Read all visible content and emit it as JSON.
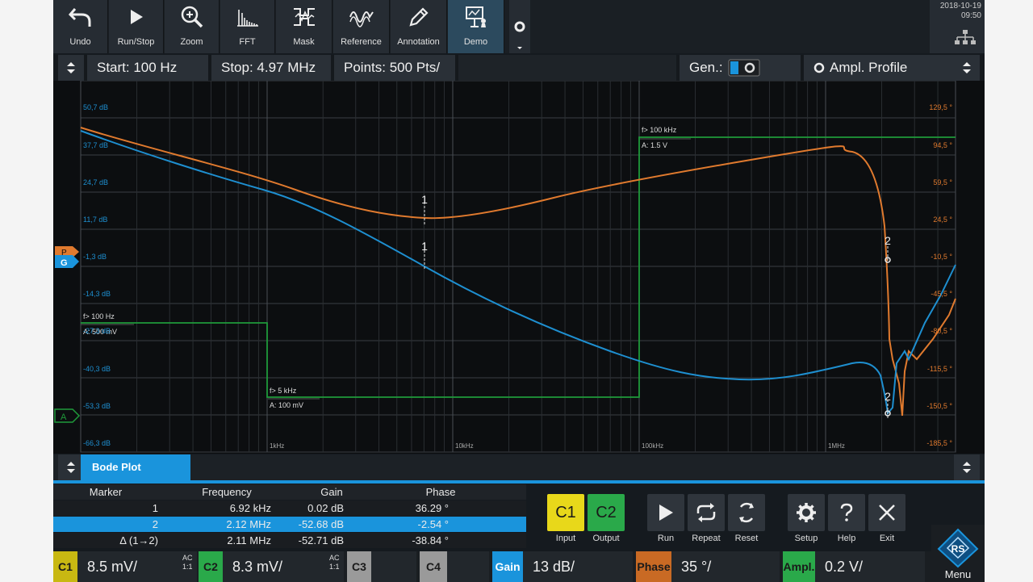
{
  "toolbar": {
    "buttons": [
      {
        "label": "Undo",
        "icon": "undo-icon"
      },
      {
        "label": "Run/Stop",
        "icon": "play-icon"
      },
      {
        "label": "Zoom",
        "icon": "zoom-icon"
      },
      {
        "label": "FFT",
        "icon": "fft-icon"
      },
      {
        "label": "Mask",
        "icon": "mask-icon"
      },
      {
        "label": "Reference",
        "icon": "reference-icon"
      },
      {
        "label": "Annotation",
        "icon": "pencil-icon"
      },
      {
        "label": "Demo",
        "icon": "demo-icon"
      }
    ],
    "date": "2018-10-19",
    "time": "09:50"
  },
  "settings": {
    "start": "Start: 100 Hz",
    "stop": "Stop: 4.97 MHz",
    "points": "Points: 500 Pts/",
    "gen": "Gen.:",
    "profile": "Ampl. Profile"
  },
  "plot": {
    "gain_ticks": [
      "50,7 dB",
      "37,7 dB",
      "24,7 dB",
      "11,7 dB",
      "-1,3 dB",
      "-14,3 dB",
      "-27,3 dB",
      "-40,3 dB",
      "-53,3 dB",
      "-66,3 dB"
    ],
    "phase_ticks": [
      "129,5 °",
      "94,5 °",
      "59,5 °",
      "24,5 °",
      "-10,5 °",
      "-45,5 °",
      "-80,5 °",
      "-115,5 °",
      "-150,5 °",
      "-185,5 °"
    ],
    "freq_ticks": [
      "1kHz",
      "10kHz",
      "100kHz",
      "1MHz"
    ],
    "profile_labels": [
      {
        "f": "f> 100 Hz",
        "a": "A: 500 mV"
      },
      {
        "f": "f> 5 kHz",
        "a": "A: 100 mV"
      },
      {
        "f": "f> 100 kHz",
        "a": "A: 1.5 V"
      }
    ],
    "markers": [
      "1",
      "1",
      "2",
      "2"
    ],
    "left_tags": [
      "P",
      "G",
      "A"
    ],
    "colors": {
      "gain": "#1e8fd0",
      "phase": "#e07a2e",
      "profile": "#1f9a3a",
      "grid": "#3a3f44"
    }
  },
  "bode": {
    "title": "Bode Plot"
  },
  "marker_table": {
    "headers": [
      "Marker",
      "Frequency",
      "Gain",
      "Phase"
    ],
    "rows": [
      [
        "1",
        "6.92 kHz",
        "0.02 dB",
        "36.29 °"
      ],
      [
        "2",
        "2.12 MHz",
        "-52.68 dB",
        "-2.54 °"
      ],
      [
        "Δ (1→2)",
        "2.11 MHz",
        "-52.71 dB",
        "-38.84 °"
      ]
    ]
  },
  "controls": {
    "input": {
      "tag": "C1",
      "label": "Input"
    },
    "output": {
      "tag": "C2",
      "label": "Output"
    },
    "run": "Run",
    "repeat": "Repeat",
    "reset": "Reset",
    "setup": "Setup",
    "help": "Help",
    "exit": "Exit",
    "menu": "Menu"
  },
  "status": {
    "c1": {
      "tag": "C1",
      "value": "8.5 mV/",
      "ac": "AC",
      "ratio": "1:1"
    },
    "c2": {
      "tag": "C2",
      "value": "8.3 mV/",
      "ac": "AC",
      "ratio": "1:1"
    },
    "c3": {
      "tag": "C3"
    },
    "c4": {
      "tag": "C4"
    },
    "gain": {
      "tag": "Gain",
      "value": "13 dB/"
    },
    "phase": {
      "tag": "Phase",
      "value": "35 °/"
    },
    "ampl": {
      "tag": "Ampl.",
      "value": "0.2 V/"
    }
  }
}
